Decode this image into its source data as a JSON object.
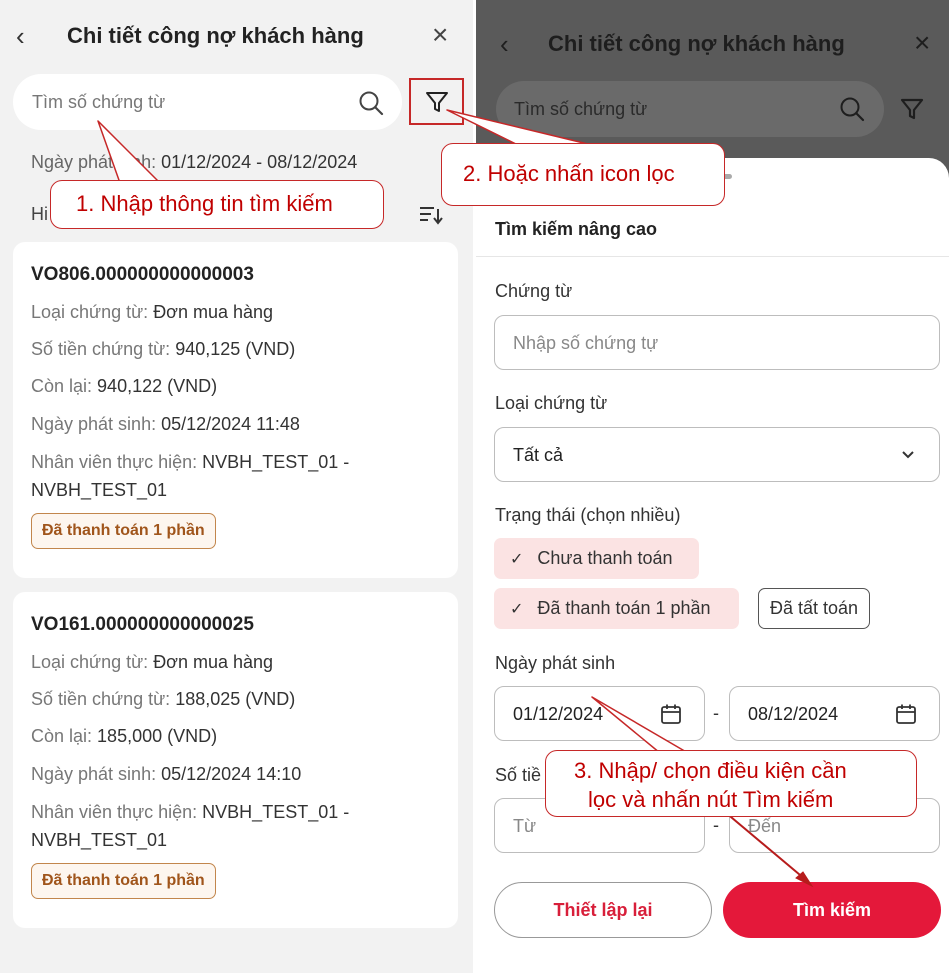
{
  "left": {
    "title": "Chi tiết công nợ khách hàng",
    "back_glyph": "‹",
    "close_glyph": "×",
    "search_placeholder": "Tìm số chứng từ",
    "date_label": "Ngày phát sinh:",
    "date_value": "01/12/2024 - 08/12/2024",
    "show_label": "Hi",
    "cards": [
      {
        "code": "VO806.000000000000003",
        "type_label": "Loại chứng từ:",
        "type_value": "Đơn mua hàng",
        "amount_label": "Số tiền chứng từ:",
        "amount_value": "940,125 (VND)",
        "remain_label": "Còn lại:",
        "remain_value": "940,122 (VND)",
        "date_label": "Ngày phát sinh:",
        "date_value": "05/12/2024 11:48",
        "staff_label": "Nhân viên thực hiện:",
        "staff_value": "NVBH_TEST_01 -",
        "staff_value2": "NVBH_TEST_01",
        "status": "Đã thanh toán 1 phần"
      },
      {
        "code": "VO161.000000000000025",
        "type_label": "Loại chứng từ:",
        "type_value": "Đơn mua hàng",
        "amount_label": "Số tiền chứng từ:",
        "amount_value": "188,025 (VND)",
        "remain_label": "Còn lại:",
        "remain_value": "185,000 (VND)",
        "date_label": "Ngày phát sinh:",
        "date_value": "05/12/2024 14:10",
        "staff_label": "Nhân viên thực hiện:",
        "staff_value": "NVBH_TEST_01 -",
        "staff_value2": "NVBH_TEST_01",
        "status": "Đã thanh toán 1 phần"
      }
    ]
  },
  "right": {
    "title": "Chi tiết công nợ khách hàng",
    "back_glyph": "‹",
    "close_glyph": "×",
    "search_placeholder": "Tìm số chứng từ",
    "sheet_title": "Tìm kiếm nâng cao",
    "doc_label": "Chứng từ",
    "doc_placeholder": "Nhập số chứng tự",
    "doc_type_label": "Loại chứng từ",
    "doc_type_value": "Tất cả",
    "status_label": "Trạng thái (chọn nhiều)",
    "status_options": [
      {
        "label": "Chưa thanh toán",
        "selected": true
      },
      {
        "label": "Đã thanh toán 1 phần",
        "selected": true
      },
      {
        "label": "Đã tất toán",
        "selected": false
      }
    ],
    "check_glyph": "✓",
    "date_label": "Ngày phát sinh",
    "date_from": "01/12/2024",
    "date_to": "08/12/2024",
    "range_sep": "-",
    "amount_label": "Số tiề",
    "amount_from_ph": "Từ",
    "amount_to_ph": "Đến",
    "reset_label": "Thiết lập lại",
    "search_label": "Tìm kiếm"
  },
  "annotations": {
    "step1": "1. Nhập thông tin tìm kiếm",
    "step2": "2. Hoặc nhấn icon lọc",
    "step3_line1": "3. Nhập/ chọn điều kiện cần",
    "step3_line2": "lọc và nhấn nút Tìm kiếm"
  },
  "colors": {
    "accent": "#e4183a",
    "annotation": "#c00000",
    "badge_text": "#a0551b",
    "chip_selected": "#fbe3e3"
  }
}
